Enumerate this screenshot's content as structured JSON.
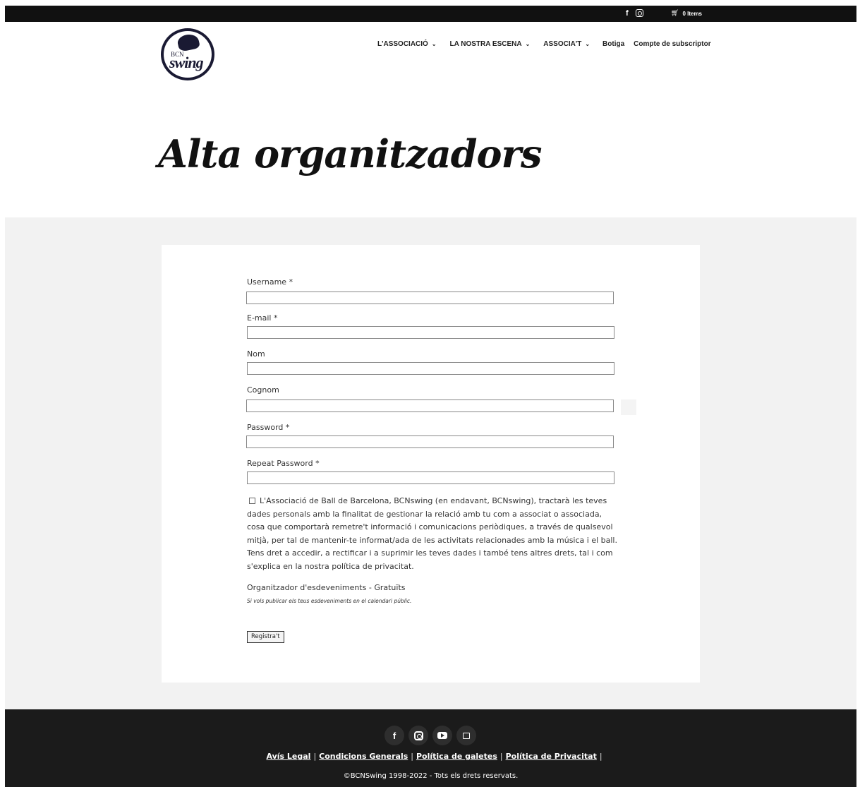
{
  "topbar": {
    "facebook_icon": "f",
    "instagram_icon": "instagram-icon",
    "cart_icon": "cart-icon",
    "cart_label": "0 Items"
  },
  "logo": {
    "top_text": "BCN",
    "main_text": "swing"
  },
  "nav": {
    "items": [
      {
        "label": "L'ASSOCIACIÓ",
        "has_dropdown": true
      },
      {
        "label": "LA NOSTRA ESCENA",
        "has_dropdown": true
      },
      {
        "label": "ASSOCIA'T",
        "has_dropdown": true
      },
      {
        "label": "Botiga",
        "has_dropdown": false
      },
      {
        "label": "Compte de subscriptor",
        "has_dropdown": false
      }
    ]
  },
  "page": {
    "title": "Alta organitzadors"
  },
  "form": {
    "fields": [
      {
        "label": "Username *",
        "value": ""
      },
      {
        "label": "E-mail *",
        "value": ""
      },
      {
        "label": "Nom",
        "value": ""
      },
      {
        "label": "Cognom",
        "value": ""
      },
      {
        "label": "Password *",
        "value": ""
      },
      {
        "label": "Repeat Password *",
        "value": ""
      }
    ],
    "consent_text": "L'Associació de Ball de Barcelona, BCNswing (en endavant, BCNswing), tractarà les teves dades personals amb la finalitat de gestionar la relació amb tu com a associat o associada, cosa que comportarà remetre't informació i comunicacions periòdiques, a través de qualsevol mitjà, per tal de mantenir-te informat/ada de les activitats relacionades amb la música i el ball. Tens dret a accedir, a rectificar i a suprimir les teves dades i també tens altres drets, tal i com s'explica en la nostra política de privacitat.",
    "consent_checked": false,
    "role_title": "Organitzador d'esdeveniments - Gratuïts",
    "role_description": "Si vols publicar els teus esdeveniments en el calendari públic.",
    "submit_label": "Registra't"
  },
  "footer": {
    "social": [
      "facebook-icon",
      "instagram-icon",
      "youtube-icon",
      "square-icon"
    ],
    "facebook_glyph": "f",
    "links": [
      "Avís Legal",
      "Condicions Generals",
      "Política de galetes",
      "Política de Privacitat"
    ],
    "separator": "|",
    "copyright": "©BCNSwing 1998-2022 - Tots els drets reservats."
  },
  "colors": {
    "topbar_bg": "#111111",
    "band_bg": "#f2f2f2",
    "footer_bg": "#1b1b1b",
    "logo_ink": "#1a1a33"
  }
}
